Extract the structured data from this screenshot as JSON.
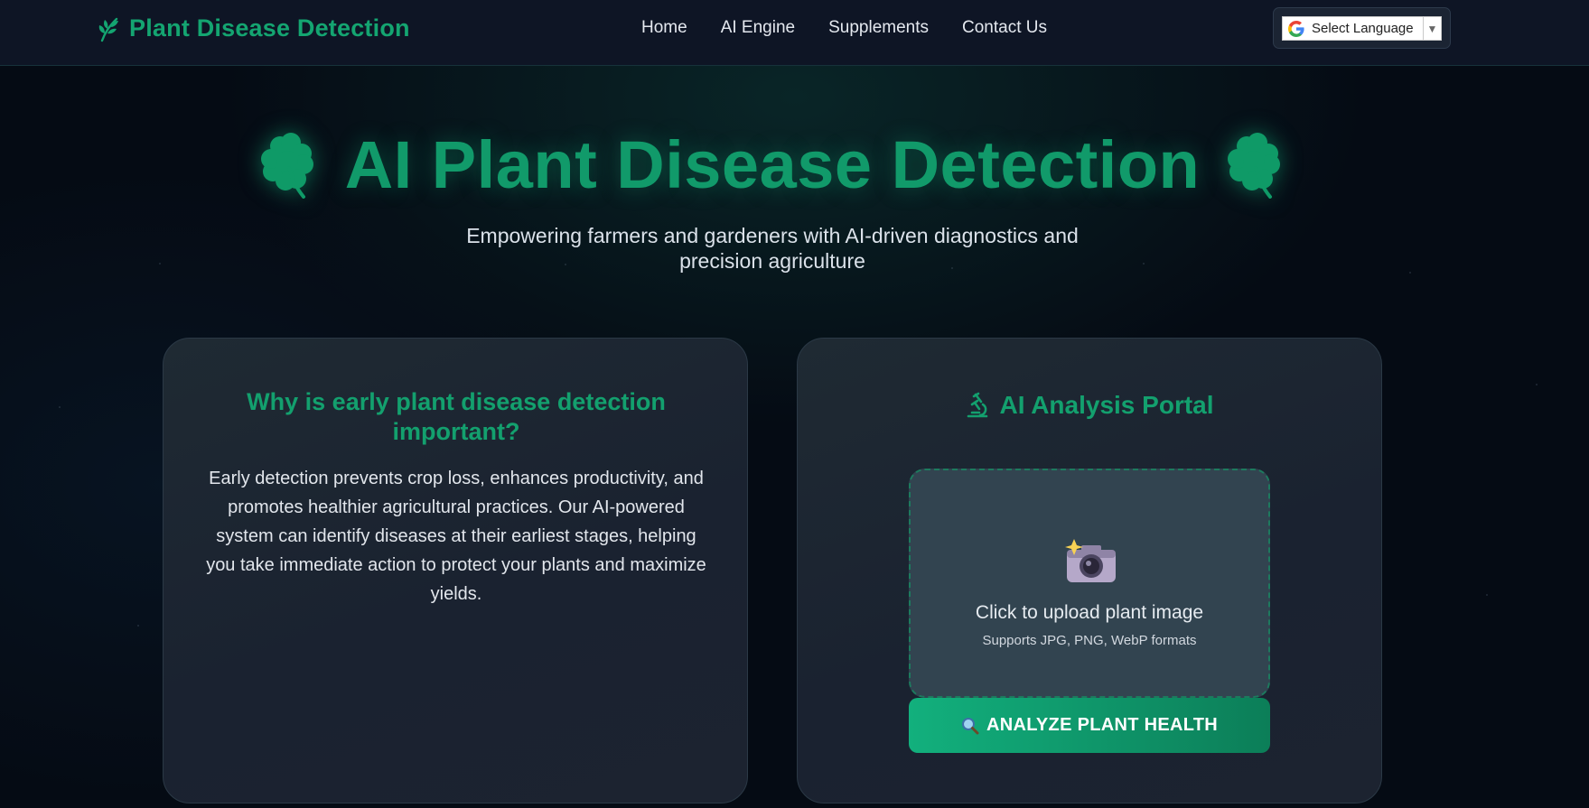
{
  "header": {
    "brand": "Plant Disease Detection",
    "brand_icon": "leaf-sprig-icon",
    "nav": [
      {
        "label": "Home"
      },
      {
        "label": "AI Engine"
      },
      {
        "label": "Supplements"
      },
      {
        "label": "Contact Us"
      }
    ],
    "language": {
      "label": "Select Language",
      "icon": "google-g-icon"
    }
  },
  "hero": {
    "title": "AI Plant Disease Detection",
    "title_icon": "four-leaf-clover-icon",
    "subtitle": "Empowering farmers and gardeners with AI-driven diagnostics and precision agriculture"
  },
  "info_card": {
    "title": "Why is early plant disease detection important?",
    "body": "Early detection prevents crop loss, enhances productivity, and promotes healthier agricultural practices. Our AI-powered system can identify diseases at their earliest stages, helping you take immediate action to protect your plants and maximize yields."
  },
  "portal": {
    "title": "AI Analysis Portal",
    "title_icon": "microscope-icon",
    "upload_text": "Click to upload plant image",
    "upload_hint": "Supports JPG, PNG, WebP formats",
    "upload_icon": "camera-flash-icon",
    "analyze_button": "ANALYZE PLANT HEALTH",
    "analyze_icon": "magnifier-icon"
  },
  "colors": {
    "accent": "#10a36f",
    "background": "#050b14",
    "navbar": "#0e1525",
    "card": "#1d2631",
    "upload_zone": "#324450"
  }
}
